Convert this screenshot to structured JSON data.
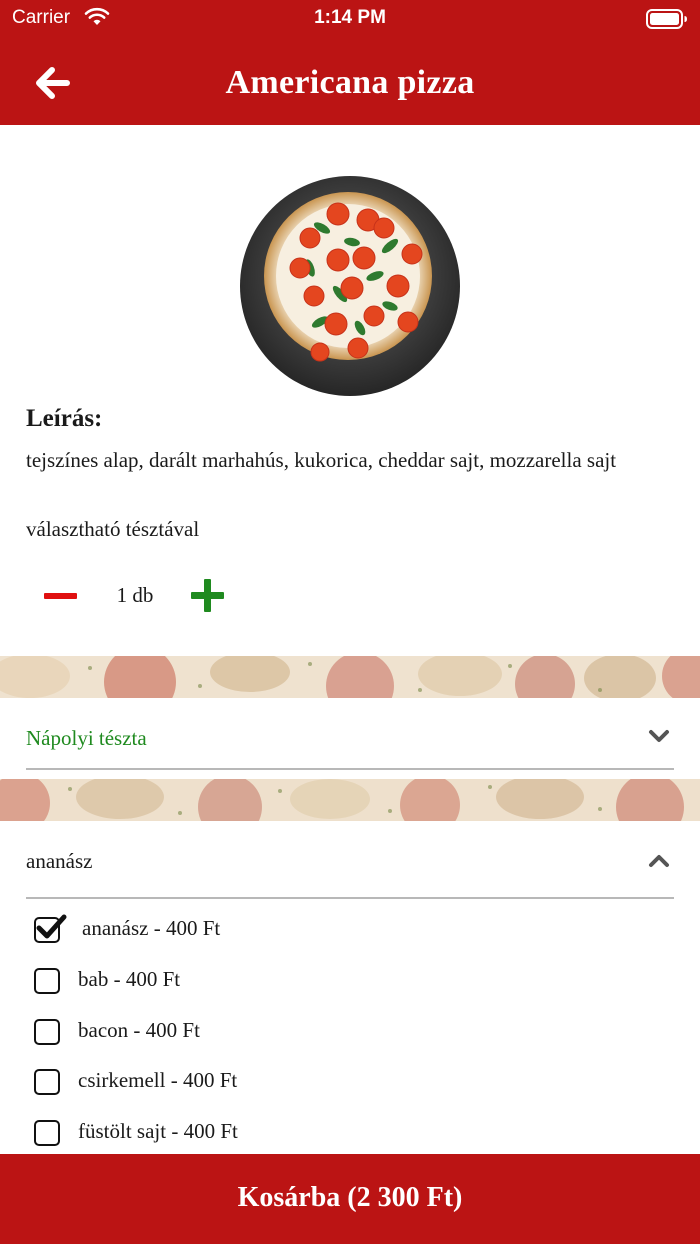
{
  "status_bar": {
    "carrier": "Carrier",
    "time": "1:14 PM",
    "wifi_icon": "wifi-icon",
    "battery_icon": "battery-icon"
  },
  "header": {
    "title": "Americana pizza",
    "back_icon": "arrow-left-icon",
    "background_color": "#bb1414"
  },
  "product": {
    "image": "pizza-photo",
    "description_heading": "Leírás:",
    "description": "tejszínes alap, darált marhahús, kukorica, cheddar sajt, mozzarella sajt",
    "extra_note": "választható tésztával"
  },
  "quantity": {
    "value": "1 db",
    "minus_icon": "minus-icon",
    "plus_icon": "plus-icon",
    "minus_color": "#e01010",
    "plus_color": "#1f8a1f"
  },
  "dough_select": {
    "selected": "Nápolyi tészta",
    "icon": "chevron-down-icon",
    "selected_color": "#1f8a1f"
  },
  "topping_select": {
    "selected": "ananász",
    "icon": "chevron-up-icon",
    "options": [
      {
        "label": "ananász - 400 Ft",
        "checked": true
      },
      {
        "label": "bab - 400 Ft",
        "checked": false
      },
      {
        "label": "bacon - 400 Ft",
        "checked": false
      },
      {
        "label": "csirkemell - 400 Ft",
        "checked": false
      },
      {
        "label": "füstölt sajt - 400 Ft",
        "checked": false
      }
    ]
  },
  "cart_button": {
    "label": "Kosárba (2 300 Ft)"
  }
}
